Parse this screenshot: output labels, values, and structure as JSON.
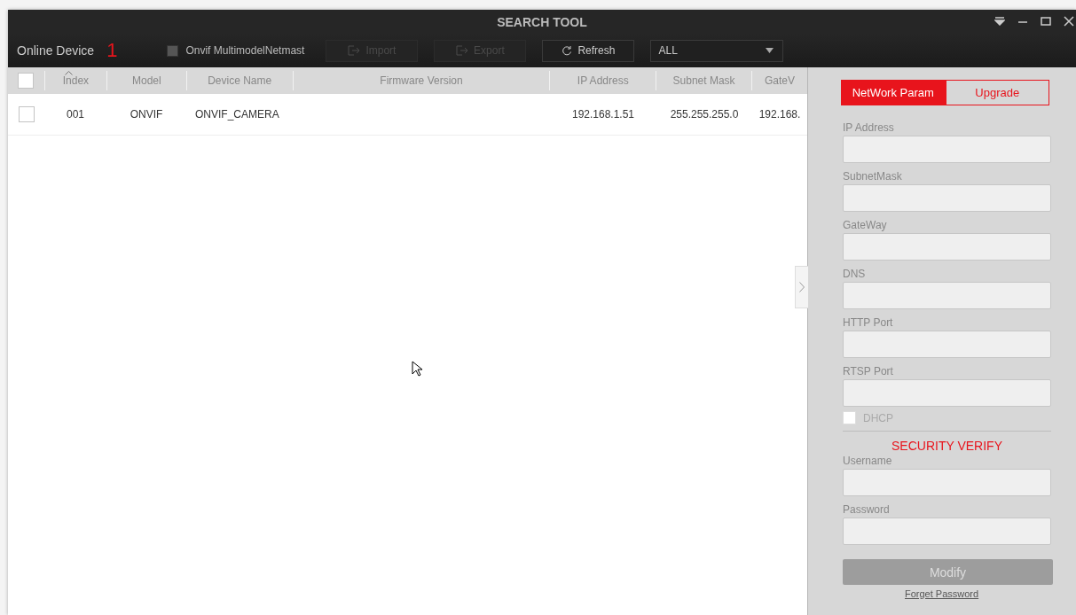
{
  "window": {
    "title": "SEARCH TOOL"
  },
  "toolbar": {
    "label": "Online Device",
    "count": "1",
    "onvif": {
      "label": "Onvif MultimodelNetmast",
      "checked": false
    },
    "buttons": [
      {
        "kind": "import",
        "label": "Import",
        "disabled": true
      },
      {
        "kind": "export",
        "label": "Export",
        "disabled": true
      },
      {
        "kind": "refresh",
        "label": "Refresh",
        "disabled": false
      }
    ],
    "filter": {
      "value": "ALL"
    }
  },
  "table": {
    "select_all": {
      "checked": false
    },
    "columns": [
      {
        "label": "Index",
        "sorted": true
      },
      {
        "label": "Model",
        "sorted": false
      },
      {
        "label": "Device Name",
        "sorted": false
      },
      {
        "label": "Firmware Version",
        "sorted": false
      },
      {
        "label": "IP Address",
        "sorted": false
      },
      {
        "label": "Subnet Mask",
        "sorted": false
      },
      {
        "label": "GateV",
        "sorted": false
      }
    ],
    "rows": [
      {
        "selected": false,
        "cells": [
          "001",
          "ONVIF",
          "ONVIF_CAMERA",
          "",
          "192.168.1.51",
          "255.255.255.0",
          "192.168."
        ]
      }
    ]
  },
  "panel": {
    "tabs": [
      {
        "label": "NetWork Param",
        "selected": true
      },
      {
        "label": "Upgrade",
        "selected": false
      }
    ],
    "fields": [
      {
        "label": "IP Address"
      },
      {
        "label": "SubnetMask"
      },
      {
        "label": "GateWay"
      },
      {
        "label": "DNS"
      },
      {
        "label": "HTTP Port"
      },
      {
        "label": "RTSP Port"
      }
    ],
    "dhcp": {
      "label": "DHCP",
      "checked": false
    },
    "security_title": "SECURITY VERIFY",
    "credentials": [
      {
        "label": "Username"
      },
      {
        "label": "Password"
      }
    ],
    "modify": {
      "label": "Modify",
      "disabled": true
    },
    "forgot_link": "Forget Password"
  }
}
